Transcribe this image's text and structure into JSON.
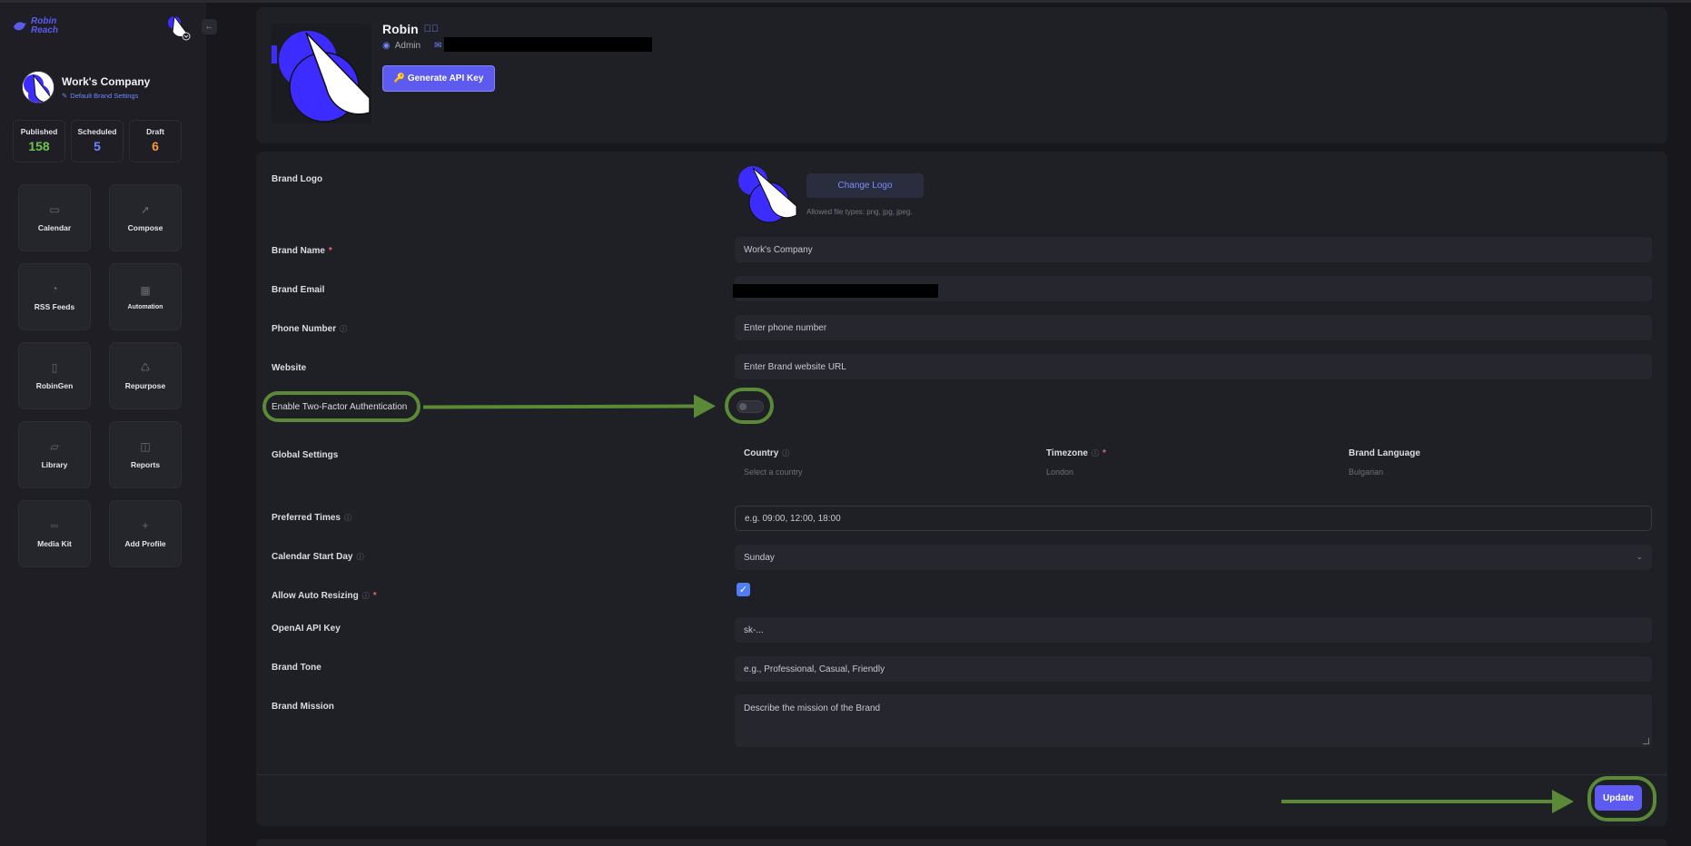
{
  "sidebar": {
    "logo_line1": "Robin",
    "logo_line2": "Reach",
    "collapse_icon": "arrow-left-icon",
    "company_name": "Work's Company",
    "company_link": "Default Brand Settings",
    "stats": [
      {
        "label": "Published",
        "value": "158",
        "color": "#6dc251"
      },
      {
        "label": "Scheduled",
        "value": "5",
        "color": "#6d86ff"
      },
      {
        "label": "Draft",
        "value": "6",
        "color": "#f59a34"
      }
    ],
    "nav": [
      {
        "label": "Calendar",
        "icon": "calendar-icon"
      },
      {
        "label": "Compose",
        "icon": "send-icon"
      },
      {
        "label": "RSS Feeds",
        "icon": "rss-icon"
      },
      {
        "label": "Automation",
        "icon": "automation-icon"
      },
      {
        "label": "RobinGen",
        "icon": "file-icon"
      },
      {
        "label": "Repurpose",
        "icon": "recycle-icon"
      },
      {
        "label": "Library",
        "icon": "folder-icon"
      },
      {
        "label": "Reports",
        "icon": "chart-icon"
      },
      {
        "label": "Media Kit",
        "icon": "grid-icon"
      },
      {
        "label": "Add Profile",
        "icon": "plus-icon"
      }
    ]
  },
  "profile": {
    "name": "Robin",
    "role": "Admin",
    "api_button": "🔑 Generate API Key"
  },
  "form": {
    "brand_logo_label": "Brand Logo",
    "change_logo_button": "Change Logo",
    "file_types": "Allowed file types: png, jpg, jpeg.",
    "brand_name_label": "Brand Name",
    "brand_name_value": "Work's Company",
    "brand_email_label": "Brand Email",
    "phone_label": "Phone Number",
    "phone_placeholder": "Enter phone number",
    "website_label": "Website",
    "website_placeholder": "Enter Brand website URL",
    "two_factor_label": "Enable Two-Factor Authentication",
    "two_factor_enabled": false,
    "global_label": "Global Settings",
    "country_label": "Country",
    "country_value": "Select a country",
    "timezone_label": "Timezone",
    "timezone_value": "London",
    "language_label": "Brand Language",
    "language_value": "Bulgarian",
    "preferred_label": "Preferred Times",
    "preferred_placeholder": "e.g. 09:00, 12:00, 18:00",
    "start_day_label": "Calendar Start Day",
    "start_day_value": "Sunday",
    "auto_resize_label": "Allow Auto Resizing",
    "auto_resize_checked": true,
    "openai_label": "OpenAI API Key",
    "openai_placeholder": "sk-...",
    "tone_label": "Brand Tone",
    "tone_placeholder": "e.g., Professional, Casual, Friendly",
    "mission_label": "Brand Mission",
    "mission_placeholder": "Describe the mission of the Brand",
    "update_button": "Update"
  },
  "colors": {
    "accent": "#5c5af0",
    "annotation": "#5a8a36",
    "background": "#17171c"
  }
}
